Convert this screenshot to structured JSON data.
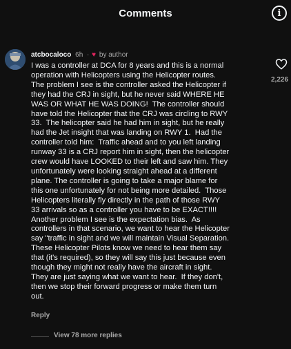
{
  "header": {
    "title": "Comments",
    "info_icon": "info-icon"
  },
  "comment": {
    "username": "atcbocaloco",
    "time": "6h",
    "separator": "·",
    "author_badge": "by author",
    "avatar_icon": "avatar",
    "text": "I was a controller at DCA for 8 years and this is a normal\noperation with Helicopters using the Helicopter routes.\nThe problem I see is the controller asked the Helicopter if\nthey had the CRJ in sight, but he never said WHERE HE\nWAS OR WHAT HE WAS DOING!  The controller should\nhave told the Helicopter that the CRJ was circling to RWY\n33.  The helicopter said he had him in sight, but he really\nhad the Jet insight that was landing on RWY 1.  Had the\ncontroller told him:  Traffic ahead and to you left landing\nrunway 33 is a CRJ report him in sight, then the helicopter\ncrew would have LOOKED to their left and saw him. They\nunfortunately were looking straight ahead at a different\nplane. The controller is going to take a major blame for\nthis one unfortunately for not being more detailed.  Those\nHelicopters literally fly directly in the path of those RWY\n33 arrivals so as a controller you have to be EXACT!!!!\nAnother problem I see is the expectation bias.  As\ncontrollers in that scenario, we want to hear the Helicopter\nsay \"traffic in sight and we will maintain Visual Separation.\nThese Helicopter Pilots know we need to hear them say\nthat (it's required), so they will say this just because even\nthough they might not really have the aircraft in sight.\nThey are just saying what we want to hear.  If they don't,\nthen we stop their forward progress or make them turn\nout.",
    "like_count": "2,226",
    "reply_label": "Reply",
    "view_replies_label": "View 78 more replies"
  },
  "colors": {
    "background": "#101010",
    "text_primary": "#f3f5f7",
    "text_secondary": "#a8a8a8",
    "heart_red": "#e0245e"
  }
}
